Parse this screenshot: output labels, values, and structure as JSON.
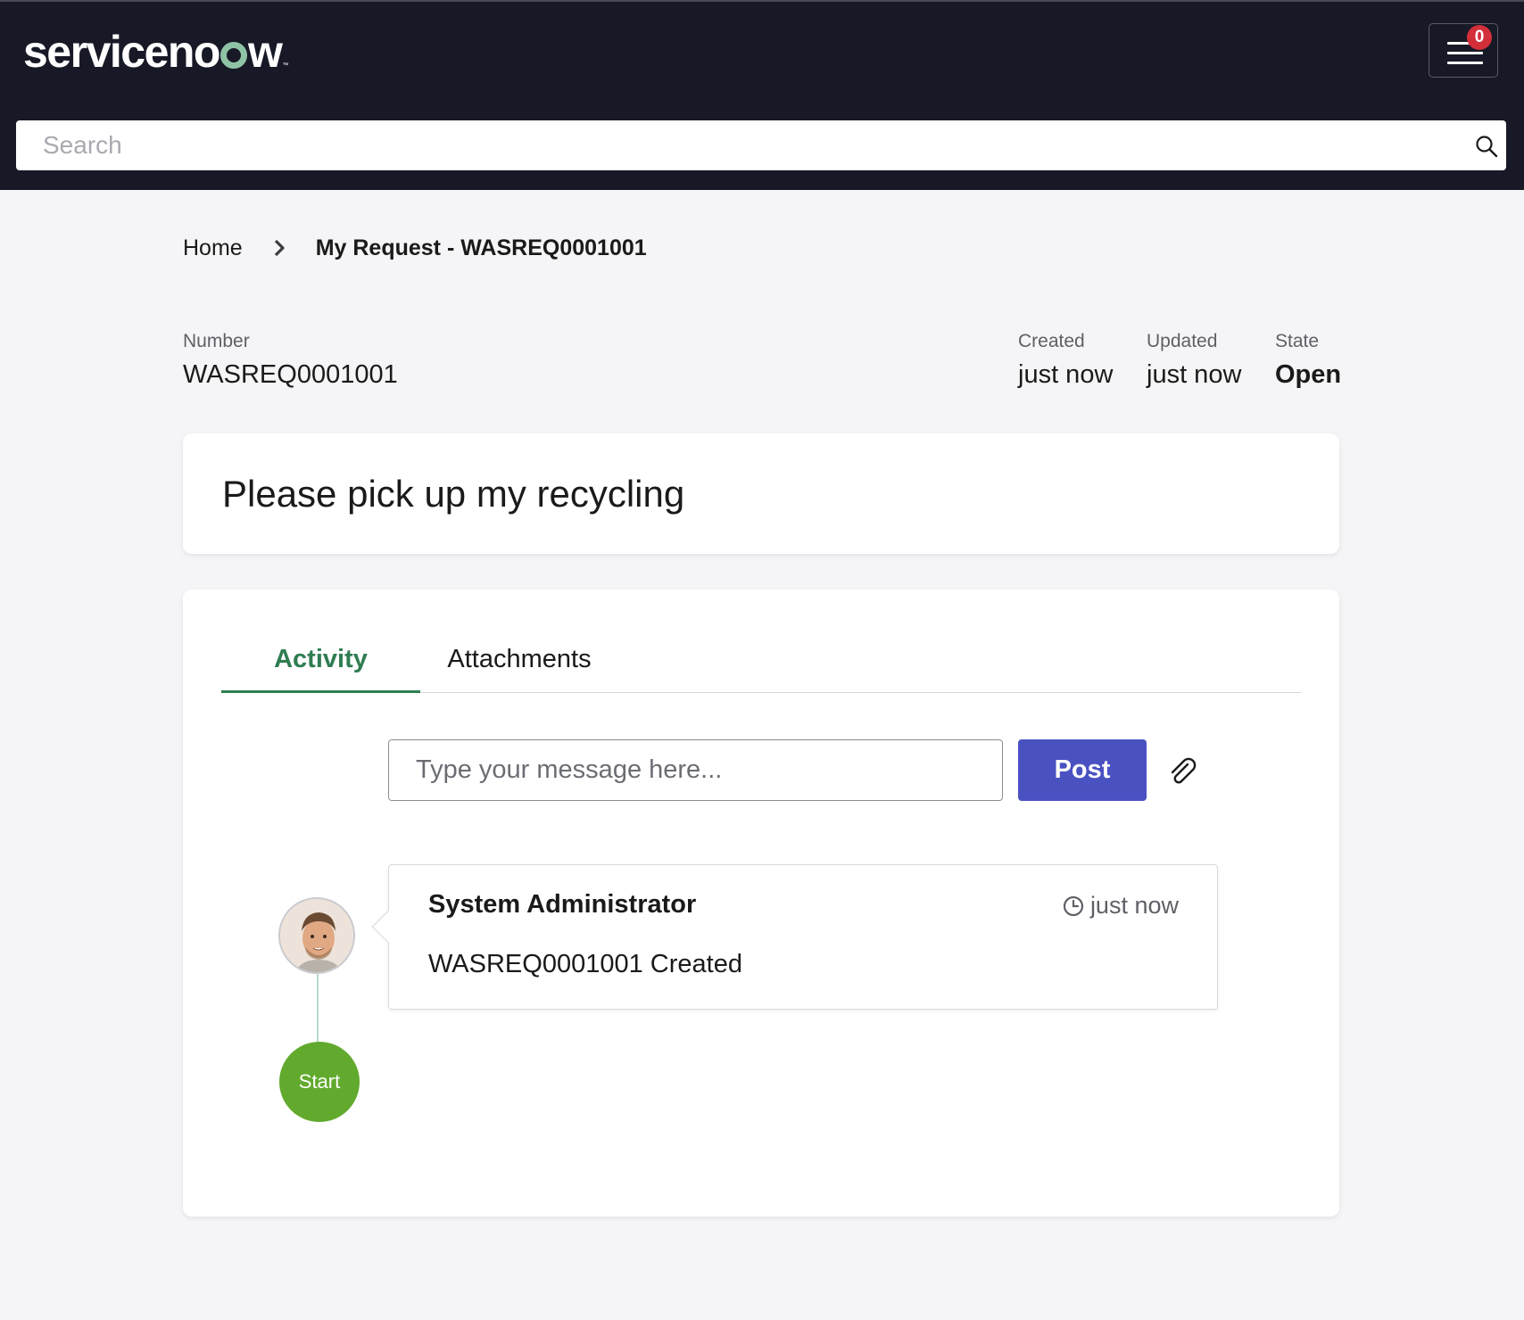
{
  "header": {
    "logo_text_prefix": "serviceno",
    "logo_text_suffix": "w",
    "logo_trademark": "™",
    "notification_count": "0",
    "menu_icon": "hamburger-menu-icon"
  },
  "search": {
    "placeholder": "Search",
    "icon": "search-icon"
  },
  "breadcrumb": {
    "home": "Home",
    "separator_icon": "chevron-right-icon",
    "current": "My Request - WASREQ0001001"
  },
  "fields": {
    "number_label": "Number",
    "number_value": "WASREQ0001001",
    "created_label": "Created",
    "created_value": "just now",
    "updated_label": "Updated",
    "updated_value": "just now",
    "state_label": "State",
    "state_value": "Open"
  },
  "request": {
    "title": "Please pick up my recycling"
  },
  "tabs": [
    {
      "label": "Activity",
      "active": true
    },
    {
      "label": "Attachments",
      "active": false
    }
  ],
  "composer": {
    "placeholder": "Type your message here...",
    "post_label": "Post",
    "attach_icon": "paperclip-icon"
  },
  "activity": {
    "entries": [
      {
        "author": "System Administrator",
        "time": "just now",
        "text": "WASREQ0001001 Created"
      }
    ],
    "start_label": "Start"
  },
  "colors": {
    "topbar": "#181926",
    "accent_green": "#2f7d52",
    "post_button": "#4a52c2",
    "start_node": "#62aa2e",
    "badge": "#d32f3a"
  }
}
